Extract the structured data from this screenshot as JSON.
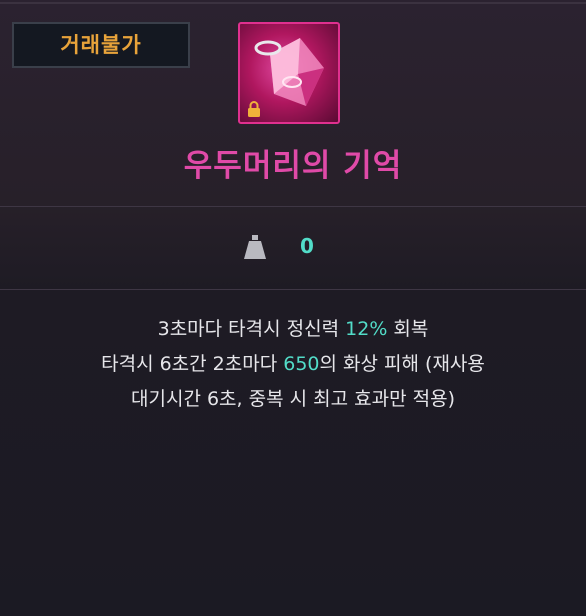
{
  "badge": "거래불가",
  "item": {
    "name": "우두머리의 기억",
    "icon": "crystal-ring-icon",
    "lock_icon": "lock-icon"
  },
  "weight": {
    "icon": "weight-icon",
    "value": "0"
  },
  "effects": [
    {
      "before": "3초마다 타격시 정신력 ",
      "value": "12%",
      "after": " 회복"
    },
    {
      "before": "타격시 6초간 2초마다 ",
      "value": "650",
      "after": "의 화상 피해 (재사용"
    },
    {
      "text": "대기시간 6초, 중복 시 최고 효과만 적용)"
    }
  ],
  "colors": {
    "title": "#e04aa8",
    "highlight": "#52dcc8",
    "badge_text": "#e8a33a",
    "icon_border": "#e0308f"
  }
}
